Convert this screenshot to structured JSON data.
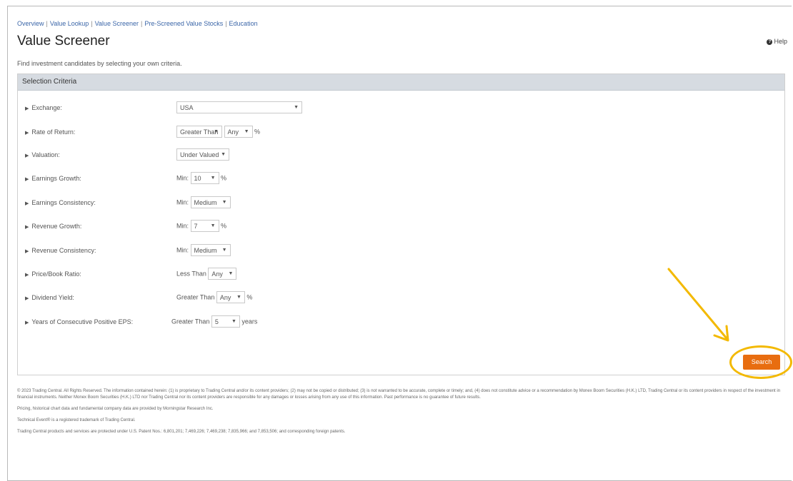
{
  "nav": {
    "items": [
      "Overview",
      "Value Lookup",
      "Value Screener",
      "Pre-Screened Value Stocks",
      "Education"
    ],
    "separator": "|"
  },
  "page": {
    "title": "Value Screener",
    "help": "Help",
    "subtitle": "Find investment candidates by selecting your own criteria."
  },
  "criteria": {
    "header": "Selection Criteria",
    "exchange": {
      "label": "Exchange:",
      "value": "USA"
    },
    "rate_of_return": {
      "label": "Rate of Return:",
      "operator": "Greater Than",
      "value": "Any",
      "unit": "%"
    },
    "valuation": {
      "label": "Valuation:",
      "value": "Under Valued"
    },
    "earnings_growth": {
      "label": "Earnings Growth:",
      "prefix": "Min:",
      "value": "10",
      "unit": "%"
    },
    "earnings_consistency": {
      "label": "Earnings Consistency:",
      "prefix": "Min:",
      "value": "Medium"
    },
    "revenue_growth": {
      "label": "Revenue Growth:",
      "prefix": "Min:",
      "value": "7",
      "unit": "%"
    },
    "revenue_consistency": {
      "label": "Revenue Consistency:",
      "prefix": "Min:",
      "value": "Medium"
    },
    "price_book": {
      "label": "Price/Book Ratio:",
      "operator": "Less Than",
      "value": "Any"
    },
    "dividend_yield": {
      "label": "Dividend Yield:",
      "operator": "Greater Than",
      "value": "Any",
      "unit": "%"
    },
    "consecutive_eps": {
      "label": "Years of Consecutive Positive EPS:",
      "operator": "Greater Than",
      "value": "5",
      "unit": "years"
    }
  },
  "actions": {
    "search_label": "Search"
  },
  "footer": {
    "copyright": "© 2023 Trading Central. All Rights Reserved. The information contained herein: (1) is proprietary to Trading Central and/or its content providers; (2) may not be copied or distributed; (3) is not warranted to be accurate, complete or timely; and, (4) does not constitute advice or a recommendation by Monex Boom Securities (H.K.) LTD, Trading Central or its content providers in respect of the investment in financial instruments. Neither Monex Boom Securities (H.K.) LTD nor Trading Central nor its content providers are responsible for any damages or losses arising from any use of this information. Past performance is no guarantee of future results.",
    "pricing": "Pricing, historical chart data and fundamental company data are provided by Morningstar Research Inc.",
    "trademark": "Technical Event® is a registered trademark of Trading Central.",
    "patents": "Trading Central products and services are protected under U.S. Patent Nos.: 6,801,201; 7,469,226; 7,469,238; 7,835,966; and 7,853,506; and corresponding foreign patents."
  },
  "colors": {
    "accent": "#e86d10",
    "highlight": "#f3b900",
    "link": "#3b66a8",
    "panel_header": "#d6dbe1"
  }
}
